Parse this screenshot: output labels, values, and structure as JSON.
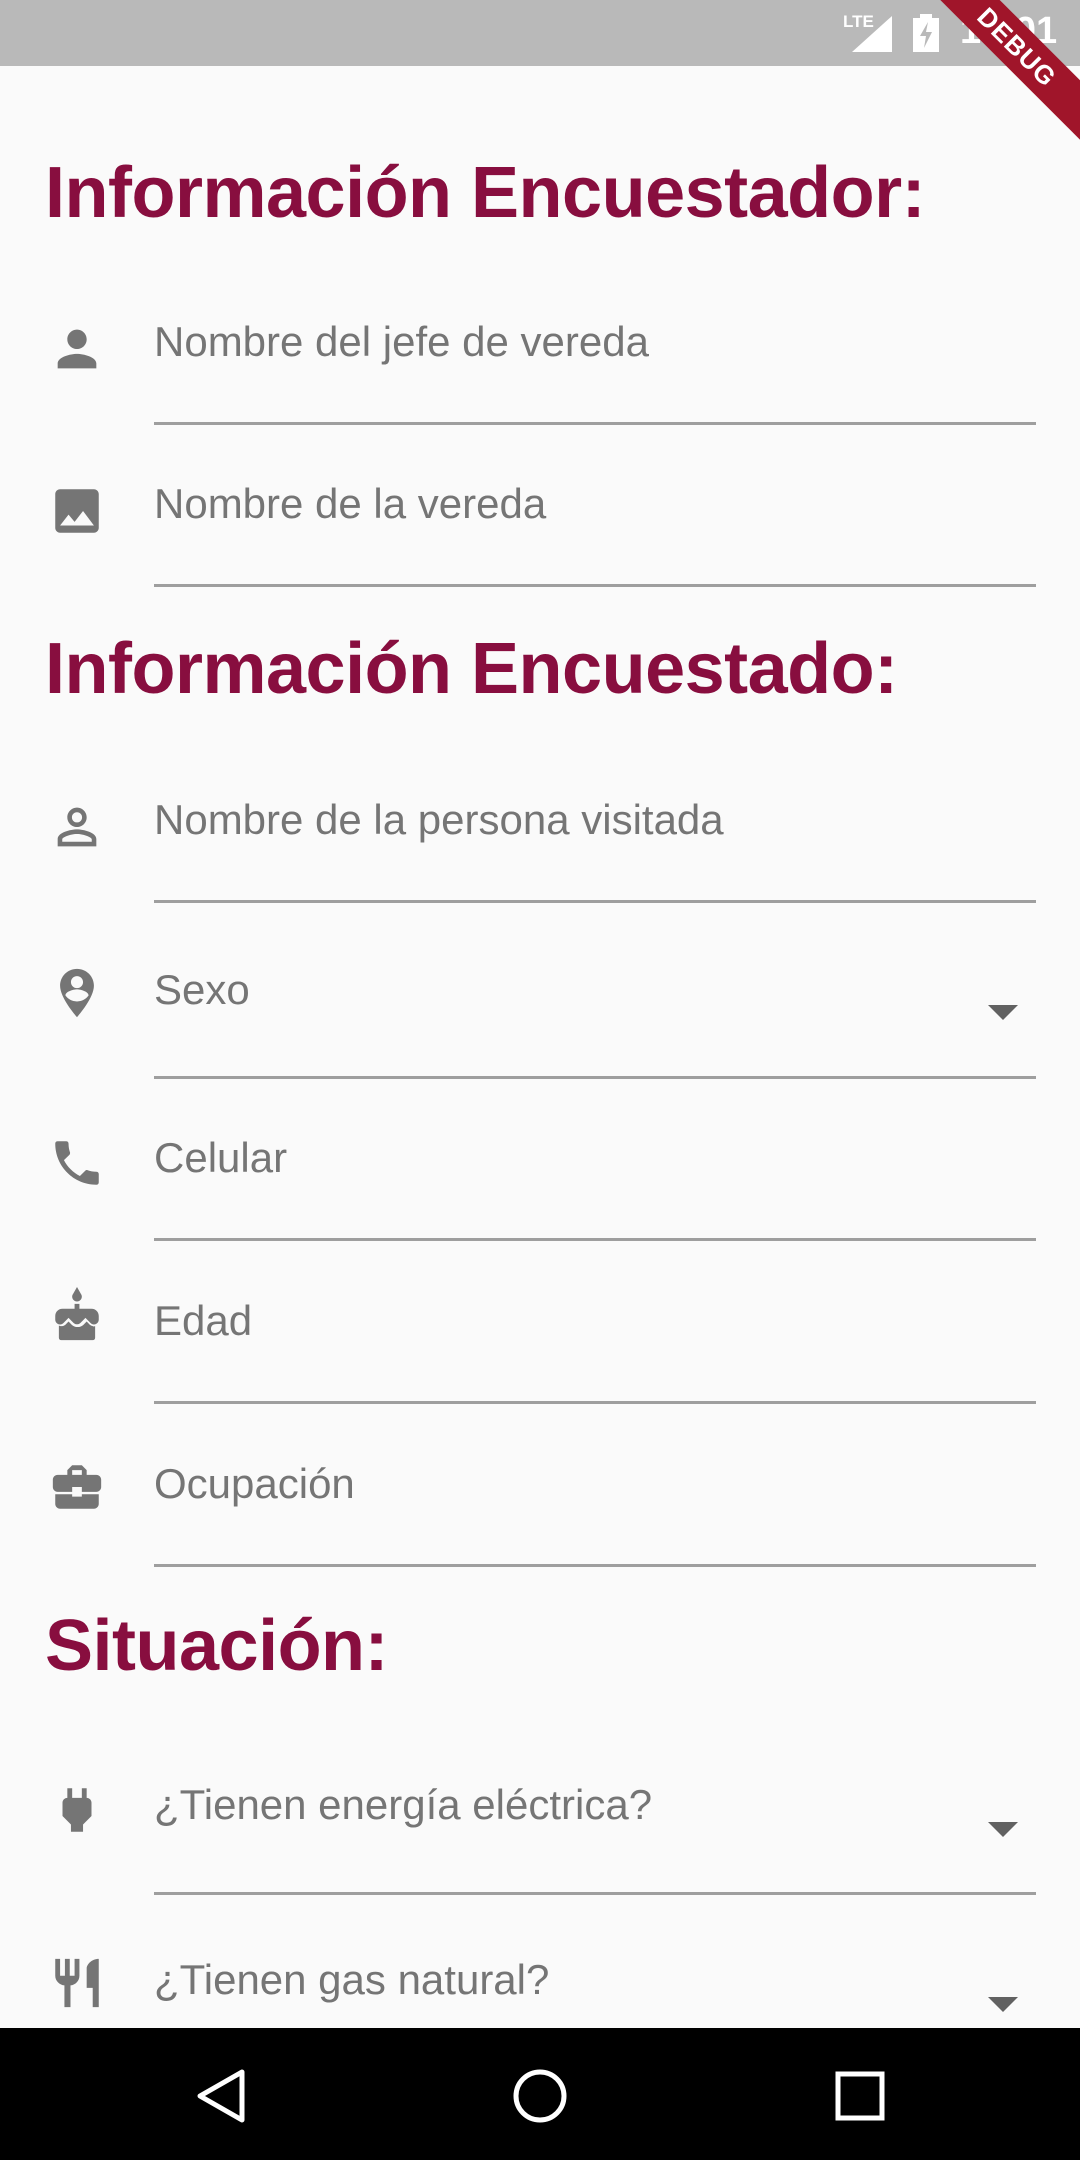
{
  "status_bar": {
    "network": "LTE",
    "time": "10:01",
    "debug_banner": "DEBUG"
  },
  "sections": [
    {
      "title": "Información Encuestador:"
    },
    {
      "title": "Información Encuestado:"
    },
    {
      "title": "Situación:"
    }
  ],
  "fields": [
    {
      "label": "Nombre del jefe de vereda",
      "icon": "person-icon"
    },
    {
      "label": "Nombre de la vereda",
      "icon": "image-icon"
    },
    {
      "label": "Nombre de la persona visitada",
      "icon": "person-outline-icon"
    },
    {
      "label": "Sexo",
      "icon": "location-pin-icon",
      "type": "dropdown"
    },
    {
      "label": "Celular",
      "icon": "phone-icon"
    },
    {
      "label": "Edad",
      "icon": "cake-icon"
    },
    {
      "label": "Ocupación",
      "icon": "briefcase-icon"
    },
    {
      "label": "¿Tienen energía eléctrica?",
      "icon": "power-plug-icon",
      "type": "dropdown"
    },
    {
      "label": "¿Tienen gas natural?",
      "icon": "restaurant-icon",
      "type": "dropdown"
    }
  ],
  "navigation": [
    "back-icon",
    "home-icon",
    "recents-icon"
  ],
  "colors": {
    "heading": "#880e3f",
    "label": "#757575",
    "status_bar": "#b9b9b9",
    "debug_banner": "#a0152a"
  }
}
